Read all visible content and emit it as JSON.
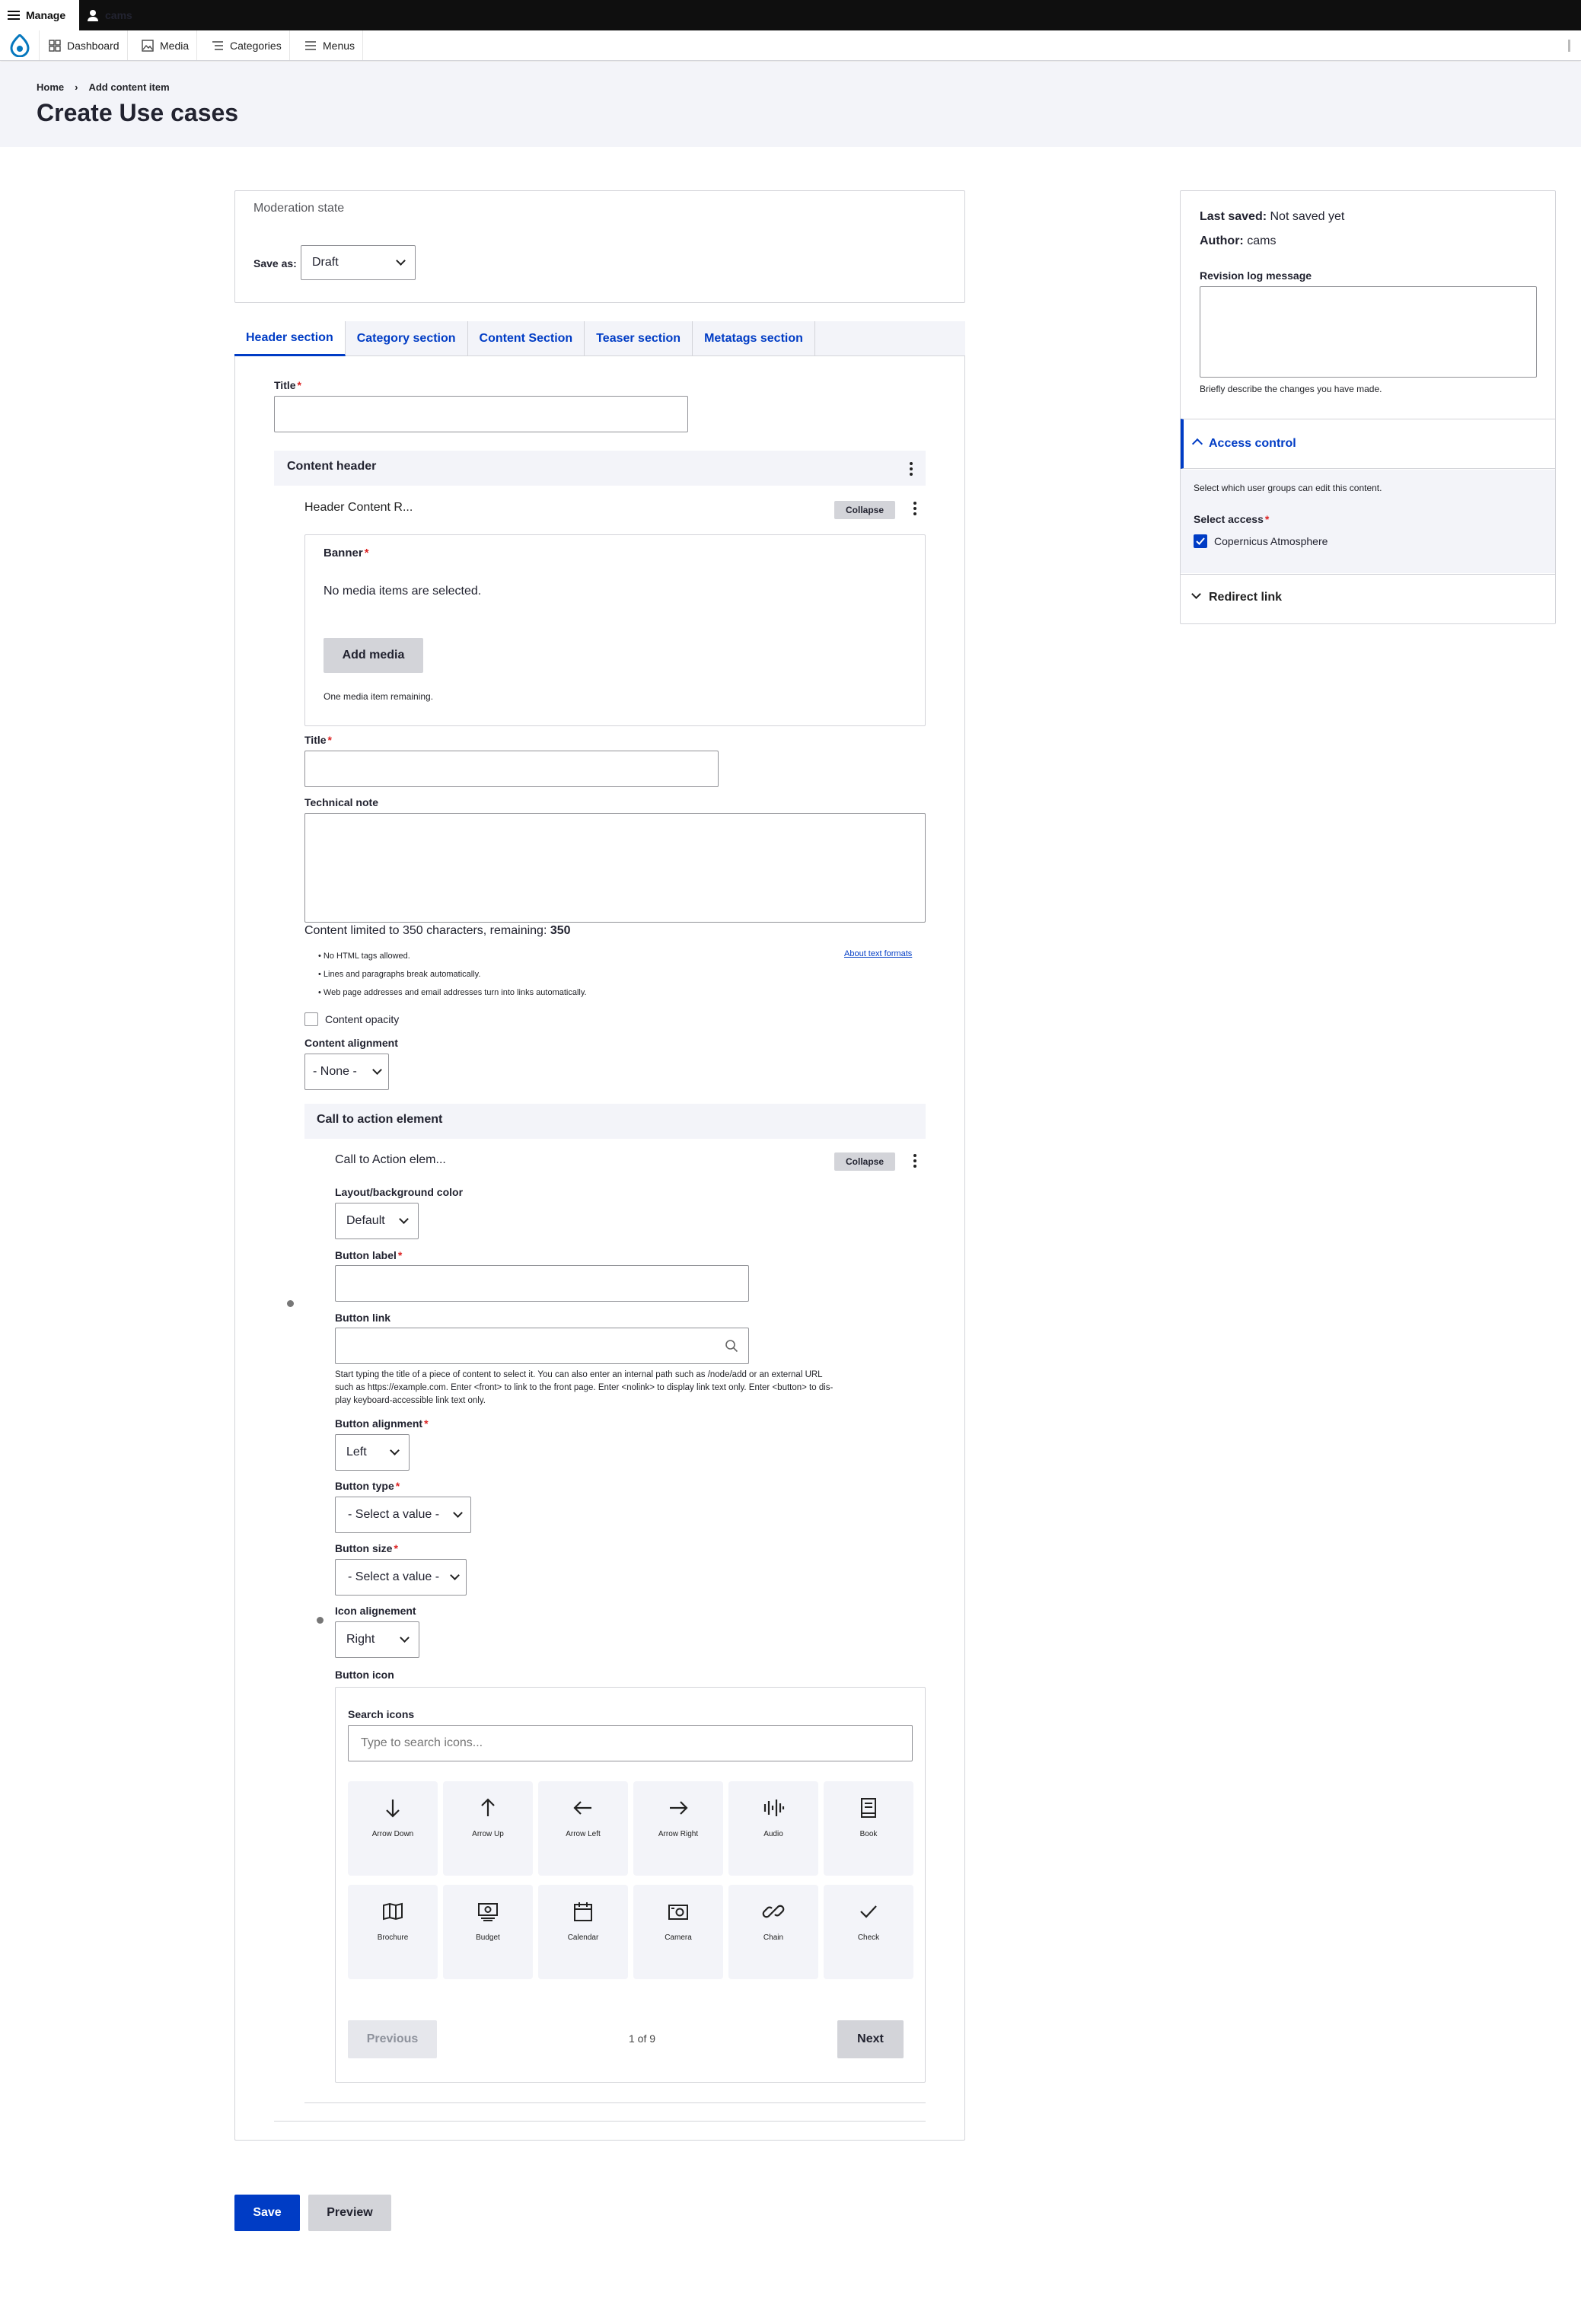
{
  "toolbar": {
    "manage": "Manage",
    "user": "cams"
  },
  "admin_menu": [
    "Dashboard",
    "Media",
    "Categories",
    "Menus"
  ],
  "breadcrumb": [
    "Home",
    "Add content item"
  ],
  "page_title": "Create Use cases",
  "moderation": {
    "title": "Moderation state",
    "save_as_label": "Save as:",
    "save_as_value": "Draft"
  },
  "tabs": [
    "Header section",
    "Category section",
    "Content Section",
    "Teaser section",
    "Metatags section"
  ],
  "form": {
    "title_label": "Title",
    "content_header": "Content header",
    "header_content_row": "Header Content R...",
    "collapse": "Collapse",
    "banner_label": "Banner",
    "no_media": "No media items are selected.",
    "add_media": "Add media",
    "media_remaining": "One media item remaining.",
    "title2_label": "Title",
    "technical_note_label": "Technical note",
    "limit_prefix": "Content limited to 350 characters, remaining: ",
    "limit_value": "350",
    "format_tips": [
      "No HTML tags allowed.",
      "Lines and paragraphs break automatically.",
      "Web page addresses and email addresses turn into links automatically."
    ],
    "about_formats": "About text formats",
    "content_opacity": "Content opacity",
    "content_alignment_label": "Content alignment",
    "content_alignment_value": "- None -",
    "cta_title": "Call to action element",
    "cta_row": "Call to Action elem...",
    "layout_bg_label": "Layout/background color",
    "layout_bg_value": "Default",
    "button_label_label": "Button label",
    "button_link_label": "Button link",
    "button_link_help_1": "Start typing the title of a piece of content to select it. You can also enter an internal path such as /node/add or an external URL",
    "button_link_help_2": "such as https://example.com. Enter <front> to link to the front page. Enter <nolink> to display link text only. Enter <button> to dis-",
    "button_link_help_3": "play keyboard-accessible link text only.",
    "button_alignment_label": "Button alignment",
    "button_alignment_value": "Left",
    "button_type_label": "Button type",
    "button_type_value": "- Select a value -",
    "button_size_label": "Button size",
    "button_size_value": "- Select a value -",
    "icon_alignment_label": "Icon alignement",
    "icon_alignment_value": "Right",
    "button_icon_label": "Button icon",
    "search_icons_label": "Search icons",
    "search_icons_placeholder": "Type to search icons...",
    "icons": [
      "Arrow Down",
      "Arrow Up",
      "Arrow Left",
      "Arrow Right",
      "Audio",
      "Book",
      "Brochure",
      "Budget",
      "Calendar",
      "Camera",
      "Chain",
      "Check"
    ],
    "prev": "Previous",
    "pager": "1 of 9",
    "next": "Next"
  },
  "sidebar": {
    "last_saved_label": "Last saved:",
    "last_saved_value": "Not saved yet",
    "author_label": "Author:",
    "author_value": "cams",
    "revision_label": "Revision log message",
    "revision_help": "Briefly describe the changes you have made.",
    "access_title": "Access control",
    "access_desc": "Select which user groups can edit this content.",
    "select_access_label": "Select access",
    "access_option": "Copernicus Atmosphere",
    "redirect_title": "Redirect link"
  },
  "actions": {
    "save": "Save",
    "preview": "Preview"
  },
  "colors": {
    "accent": "#003cc5",
    "required": "#dc2323"
  }
}
